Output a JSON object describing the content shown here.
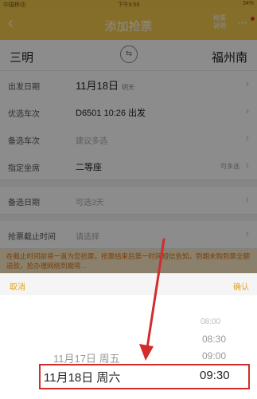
{
  "status_bar": {
    "carrier": "中国移动",
    "time": "下午9:59",
    "battery": "34%"
  },
  "header": {
    "title": "添加抢票",
    "help": "抢票说明",
    "more": "···"
  },
  "stations": {
    "from": "三明",
    "to": "福州南"
  },
  "rows": [
    {
      "label": "出发日期",
      "value": "11月18日",
      "sub": "明天"
    },
    {
      "label": "优选车次",
      "value": "D6501 10:26 出发"
    },
    {
      "label": "备选车次",
      "placeholder": "建议多选"
    },
    {
      "label": "指定坐席",
      "value": "二等座",
      "hint": "可多选"
    },
    {
      "label": "备选日期",
      "placeholder": "可选3天"
    },
    {
      "label": "抢票截止时间",
      "placeholder": "请选择"
    }
  ],
  "notice": "在截止时间前将一直为您抢票，抢票结束后第一时间短信告知，到期未购到票全额退款，抢办理网络到期将...",
  "picker": {
    "cancel": "取消",
    "confirm": "确认",
    "dates": [
      "11月17日 周五",
      "11月18日 周六"
    ],
    "times": [
      "08:00",
      "08:30",
      "09:00",
      "09:30"
    ],
    "selected_date": "11月18日 周六",
    "selected_time": "09:30"
  },
  "colors": {
    "accent": "#f3c64d",
    "picker_text": "#e3a21a",
    "highlight": "#d22c2c"
  }
}
